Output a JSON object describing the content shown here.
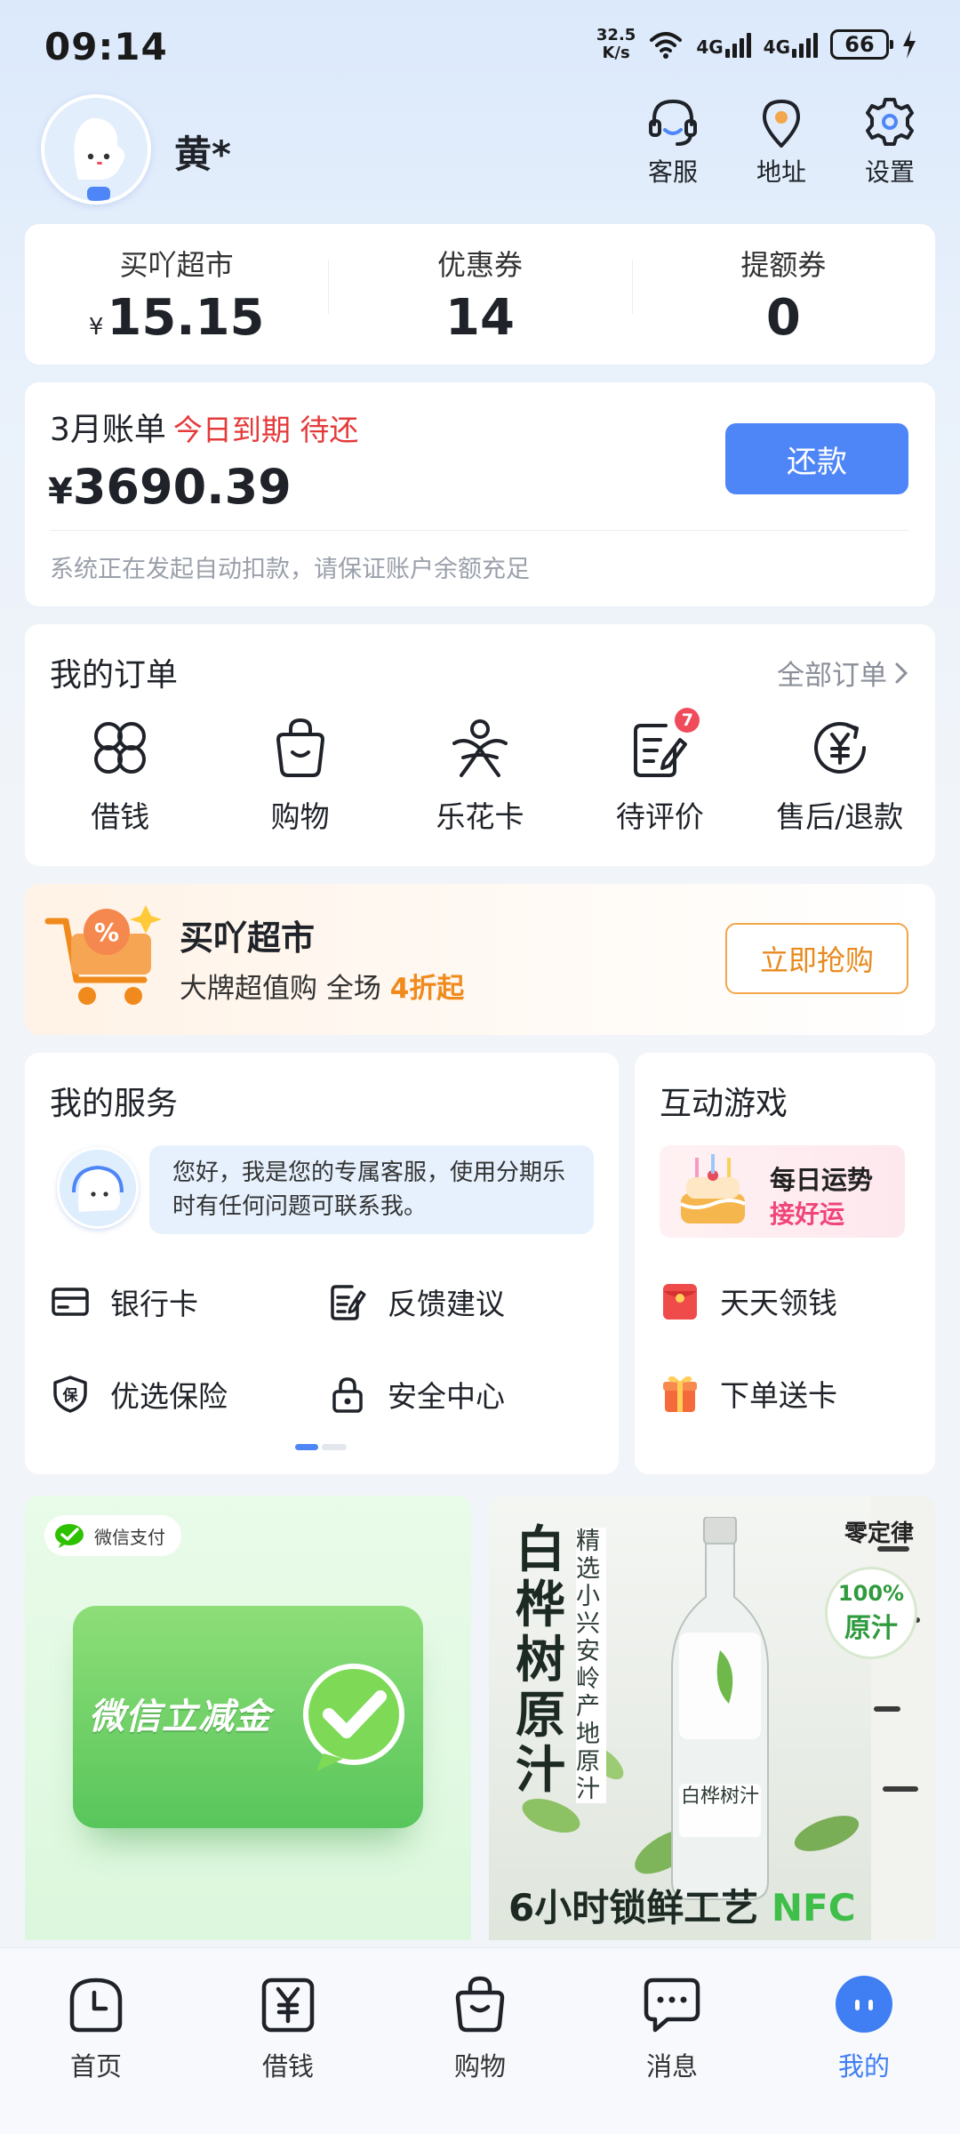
{
  "status_bar": {
    "time": "09:14",
    "net_speed_value": "32.5",
    "net_speed_unit": "K/s",
    "signal1": "4G",
    "signal2": "4G",
    "battery": "66"
  },
  "header": {
    "user_name": "黄*",
    "actions": [
      {
        "label": "客服",
        "icon": "headset-icon"
      },
      {
        "label": "地址",
        "icon": "location-pin-icon"
      },
      {
        "label": "设置",
        "icon": "gear-icon"
      }
    ]
  },
  "balances": [
    {
      "label": "买吖超市",
      "currency": "¥",
      "value": "15.15"
    },
    {
      "label": "优惠券",
      "currency": "",
      "value": "14"
    },
    {
      "label": "提额券",
      "currency": "",
      "value": "0"
    }
  ],
  "bill": {
    "title": "3月账单",
    "due_status": "今日到期 待还",
    "currency": "¥",
    "amount": "3690.39",
    "repay_label": "还款",
    "note": "系统正在发起自动扣款，请保证账户余额充足"
  },
  "orders": {
    "title": "我的订单",
    "all_label": "全部订单",
    "items": [
      {
        "label": "借钱",
        "icon": "four-petal-icon"
      },
      {
        "label": "购物",
        "icon": "shopping-bag-icon"
      },
      {
        "label": "乐花卡",
        "icon": "flower-card-icon"
      },
      {
        "label": "待评价",
        "icon": "review-clipboard-icon",
        "badge": "7"
      },
      {
        "label": "售后/退款",
        "icon": "refund-yen-icon"
      }
    ]
  },
  "market": {
    "title": "买吖超市",
    "sub_prefix": "大牌超值购 全场 ",
    "sub_highlight": "4折起",
    "button": "立即抢购"
  },
  "services": {
    "title": "我的服务",
    "bubble": "您好，我是您的专属客服，使用分期乐时有任何问题可联系我。",
    "items": [
      {
        "label": "银行卡",
        "icon": "bank-card-icon"
      },
      {
        "label": "反馈建议",
        "icon": "feedback-icon"
      },
      {
        "label": "优选保险",
        "icon": "insurance-shield-icon"
      },
      {
        "label": "安全中心",
        "icon": "lock-icon"
      }
    ]
  },
  "games": {
    "title": "互动游戏",
    "fortune_line1": "每日运势",
    "fortune_line2": "接好运",
    "items": [
      {
        "label": "天天领钱",
        "icon": "red-envelope-icon"
      },
      {
        "label": "下单送卡",
        "icon": "gift-box-icon"
      }
    ]
  },
  "promo_left": {
    "tag": "微信支付",
    "card_text": "微信立减金"
  },
  "promo_right": {
    "brand": "零定律",
    "vertical_title": "白桦树原汁",
    "vertical_sub": "精选小兴安岭产地原汁",
    "seal_top": "100%",
    "seal_bottom": "原汁",
    "bottle_label": "白桦树汁",
    "bottom_text": "6小时锁鲜工艺",
    "bottom_nfc": "NFC"
  },
  "tabbar": [
    {
      "label": "首页",
      "icon": "clock-home-icon"
    },
    {
      "label": "借钱",
      "icon": "yen-card-icon"
    },
    {
      "label": "购物",
      "icon": "shopping-bag-icon"
    },
    {
      "label": "消息",
      "icon": "chat-bubble-icon"
    },
    {
      "label": "我的",
      "icon": "profile-dots-icon",
      "active": true
    }
  ],
  "colors": {
    "accent_blue": "#4f86f7",
    "due_red": "#e53a3a",
    "market_orange": "#f08a1c",
    "tab_active": "#3f7ef3"
  }
}
